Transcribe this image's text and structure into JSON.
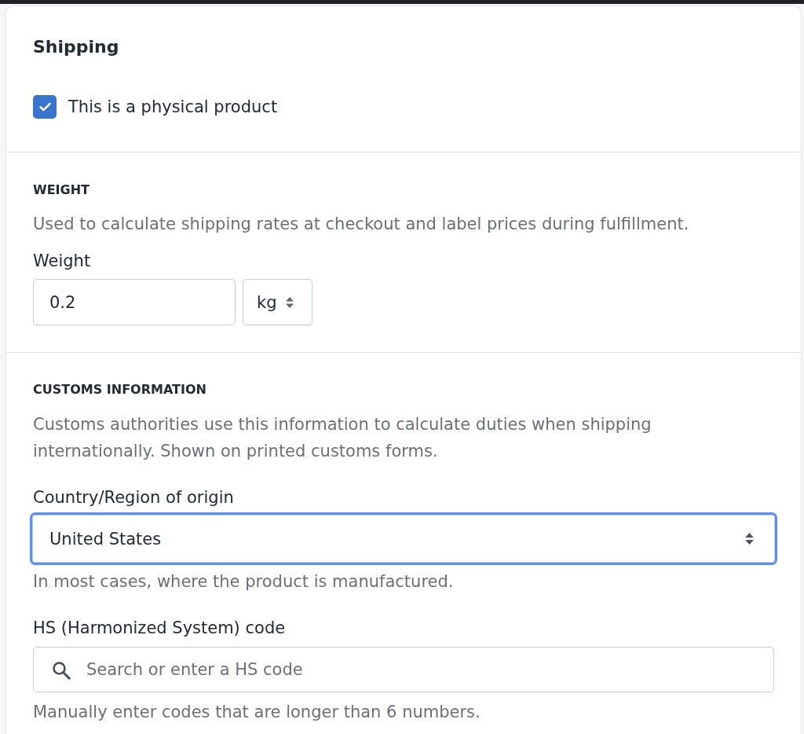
{
  "title": "Shipping",
  "physical_product": {
    "label": "This is a physical product",
    "checked": true
  },
  "weight": {
    "heading": "WEIGHT",
    "description": "Used to calculate shipping rates at checkout and label prices during fulfillment.",
    "label": "Weight",
    "value": "0.2",
    "unit": "kg"
  },
  "customs": {
    "heading": "CUSTOMS INFORMATION",
    "description": "Customs authorities use this information to calculate duties when shipping internationally. Shown on printed customs forms.",
    "country": {
      "label": "Country/Region of origin",
      "value": "United States",
      "focused": true,
      "help": "In most cases, where the product is manufactured."
    },
    "hs_code": {
      "label": "HS (Harmonized System) code",
      "placeholder": "Search or enter a HS code",
      "help": "Manually enter codes that are longer than 6 numbers."
    }
  }
}
